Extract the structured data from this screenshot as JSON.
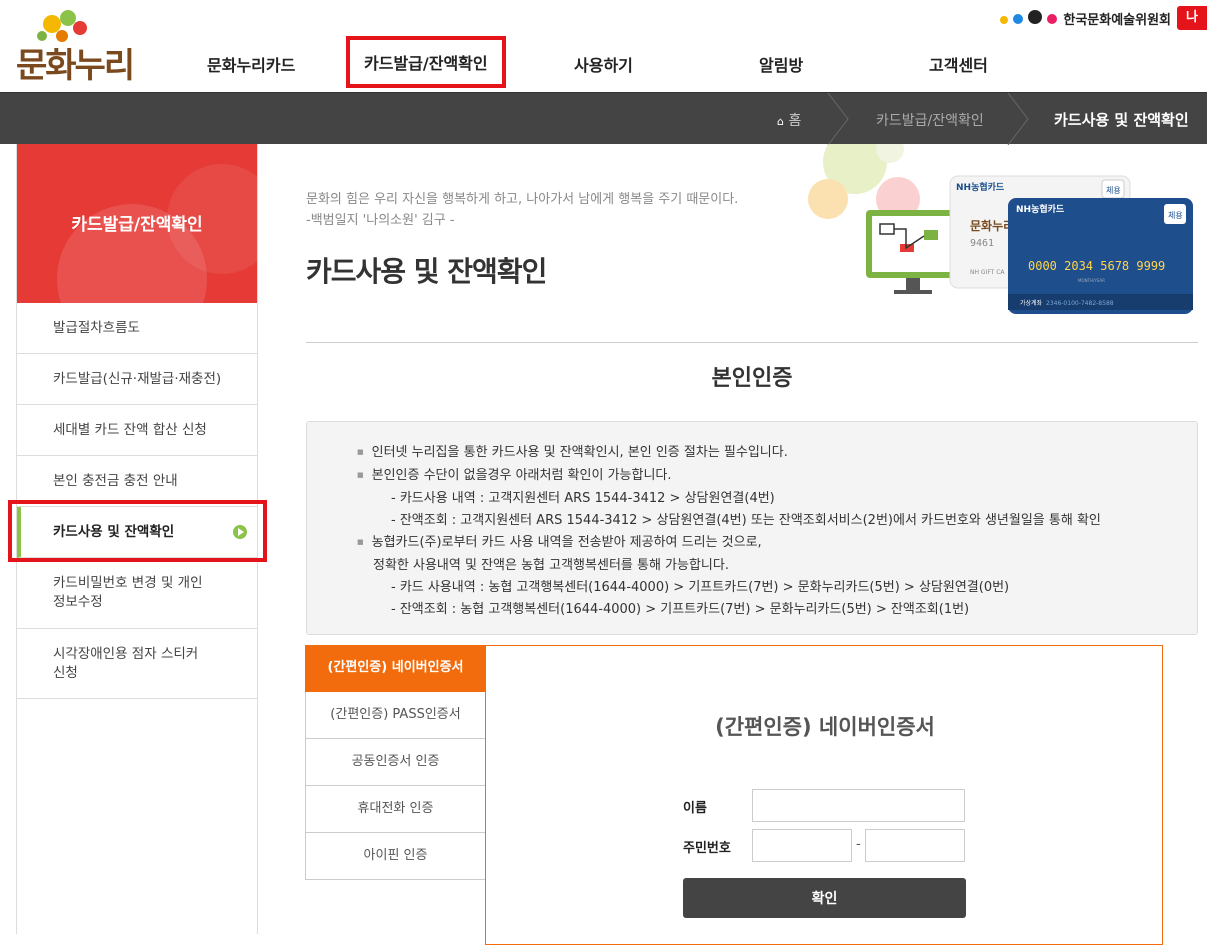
{
  "header": {
    "logo_text": "문화누리",
    "gnb": [
      {
        "label": "문화누리카드"
      },
      {
        "label": "카드발급/잔액확인"
      },
      {
        "label": "사용하기"
      },
      {
        "label": "알림방"
      },
      {
        "label": "고객센터"
      }
    ],
    "org_name": "한국문화예술위원회",
    "badge": "나"
  },
  "breadcrumb": {
    "home": "홈",
    "section": "카드발급/잔액확인",
    "current": "카드사용 및 잔액확인"
  },
  "sidebar": {
    "title": "카드발급/잔액확인",
    "items": [
      {
        "label": "발급절차흐름도"
      },
      {
        "label": "카드발급(신규·재발급·재충전)"
      },
      {
        "label": "세대별 카드 잔액 합산 신청"
      },
      {
        "label": "본인 충전금 충전 안내"
      },
      {
        "label": "카드사용 및 잔액확인"
      },
      {
        "label": "카드비밀번호 변경 및 개인 정보수정"
      },
      {
        "label": "시각장애인용 점자 스티커 신청"
      }
    ]
  },
  "content": {
    "quote_line1": "문화의 힘은 우리 자신을 행복하게 하고, 나아가서 남에게 행복을 주기 때문이다.",
    "quote_line2": "-백범일지 '나의소원' 김구 -",
    "page_title": "카드사용 및 잔액확인",
    "hero": {
      "card_brand": "NH농협카드",
      "card_badge": "체용",
      "card_back_logo": "문화누리",
      "card_back_number": "9461",
      "card_back_label": "NH GIFT CA",
      "card_number": "0000  2034  5678  9999",
      "card_valid": "MONTH/YEAR",
      "card_account_label": "가상계좌",
      "card_account": "2346-0100-7482-8588"
    },
    "section_title": "본인인증",
    "info": [
      {
        "type": "bullet",
        "text": "인터넷 누리집을 통한 카드사용 및 잔액확인시, 본인 인증 절차는 필수입니다."
      },
      {
        "type": "bullet",
        "text": "본인인증 수단이 없을경우 아래처럼 확인이 가능합니다."
      },
      {
        "type": "sub",
        "text": "- 카드사용 내역 : 고객지원센터 ARS 1544-3412 > 상담원연결(4번)"
      },
      {
        "type": "sub",
        "text": "- 잔액조회 : 고객지원센터 ARS 1544-3412 > 상담원연결(4번) 또는 잔액조회서비스(2번)에서 카드번호와 생년월일을 통해 확인"
      },
      {
        "type": "bullet",
        "text": "농협카드(주)로부터 카드 사용 내역을 전송받아 제공하여 드리는 것으로,"
      },
      {
        "type": "cont",
        "text": "정확한 사용내역 및 잔액은 농협 고객행복센터를 통해 가능합니다."
      },
      {
        "type": "sub",
        "text": "- 카드 사용내역 : 농협 고객행복센터(1644-4000) > 기프트카드(7번) > 문화누리카드(5번) > 상담원연결(0번)"
      },
      {
        "type": "sub",
        "text": "- 잔액조회 : 농협 고객행복센터(1644-4000) > 기프트카드(7번) > 문화누리카드(5번) > 잔액조회(1번)"
      }
    ]
  },
  "auth": {
    "tabs": [
      {
        "label": "(간편인증) 네이버인증서"
      },
      {
        "label": "(간편인증) PASS인증서"
      },
      {
        "label": "공동인증서 인증"
      },
      {
        "label": "휴대전화 인증"
      },
      {
        "label": "아이핀 인증"
      }
    ],
    "panel_title": "(간편인증) 네이버인증서",
    "name_label": "이름",
    "name_value": "",
    "rrn_label": "주민번호",
    "rrn_front": "",
    "rrn_back": "",
    "rrn_dash": "-",
    "confirm_label": "확인"
  },
  "colors": {
    "accent_red": "#e53a35",
    "highlight_red": "#e5141b",
    "tab_orange": "#f26c0d",
    "active_green": "#8bc34a",
    "breadcrumb_bg": "#444444"
  }
}
